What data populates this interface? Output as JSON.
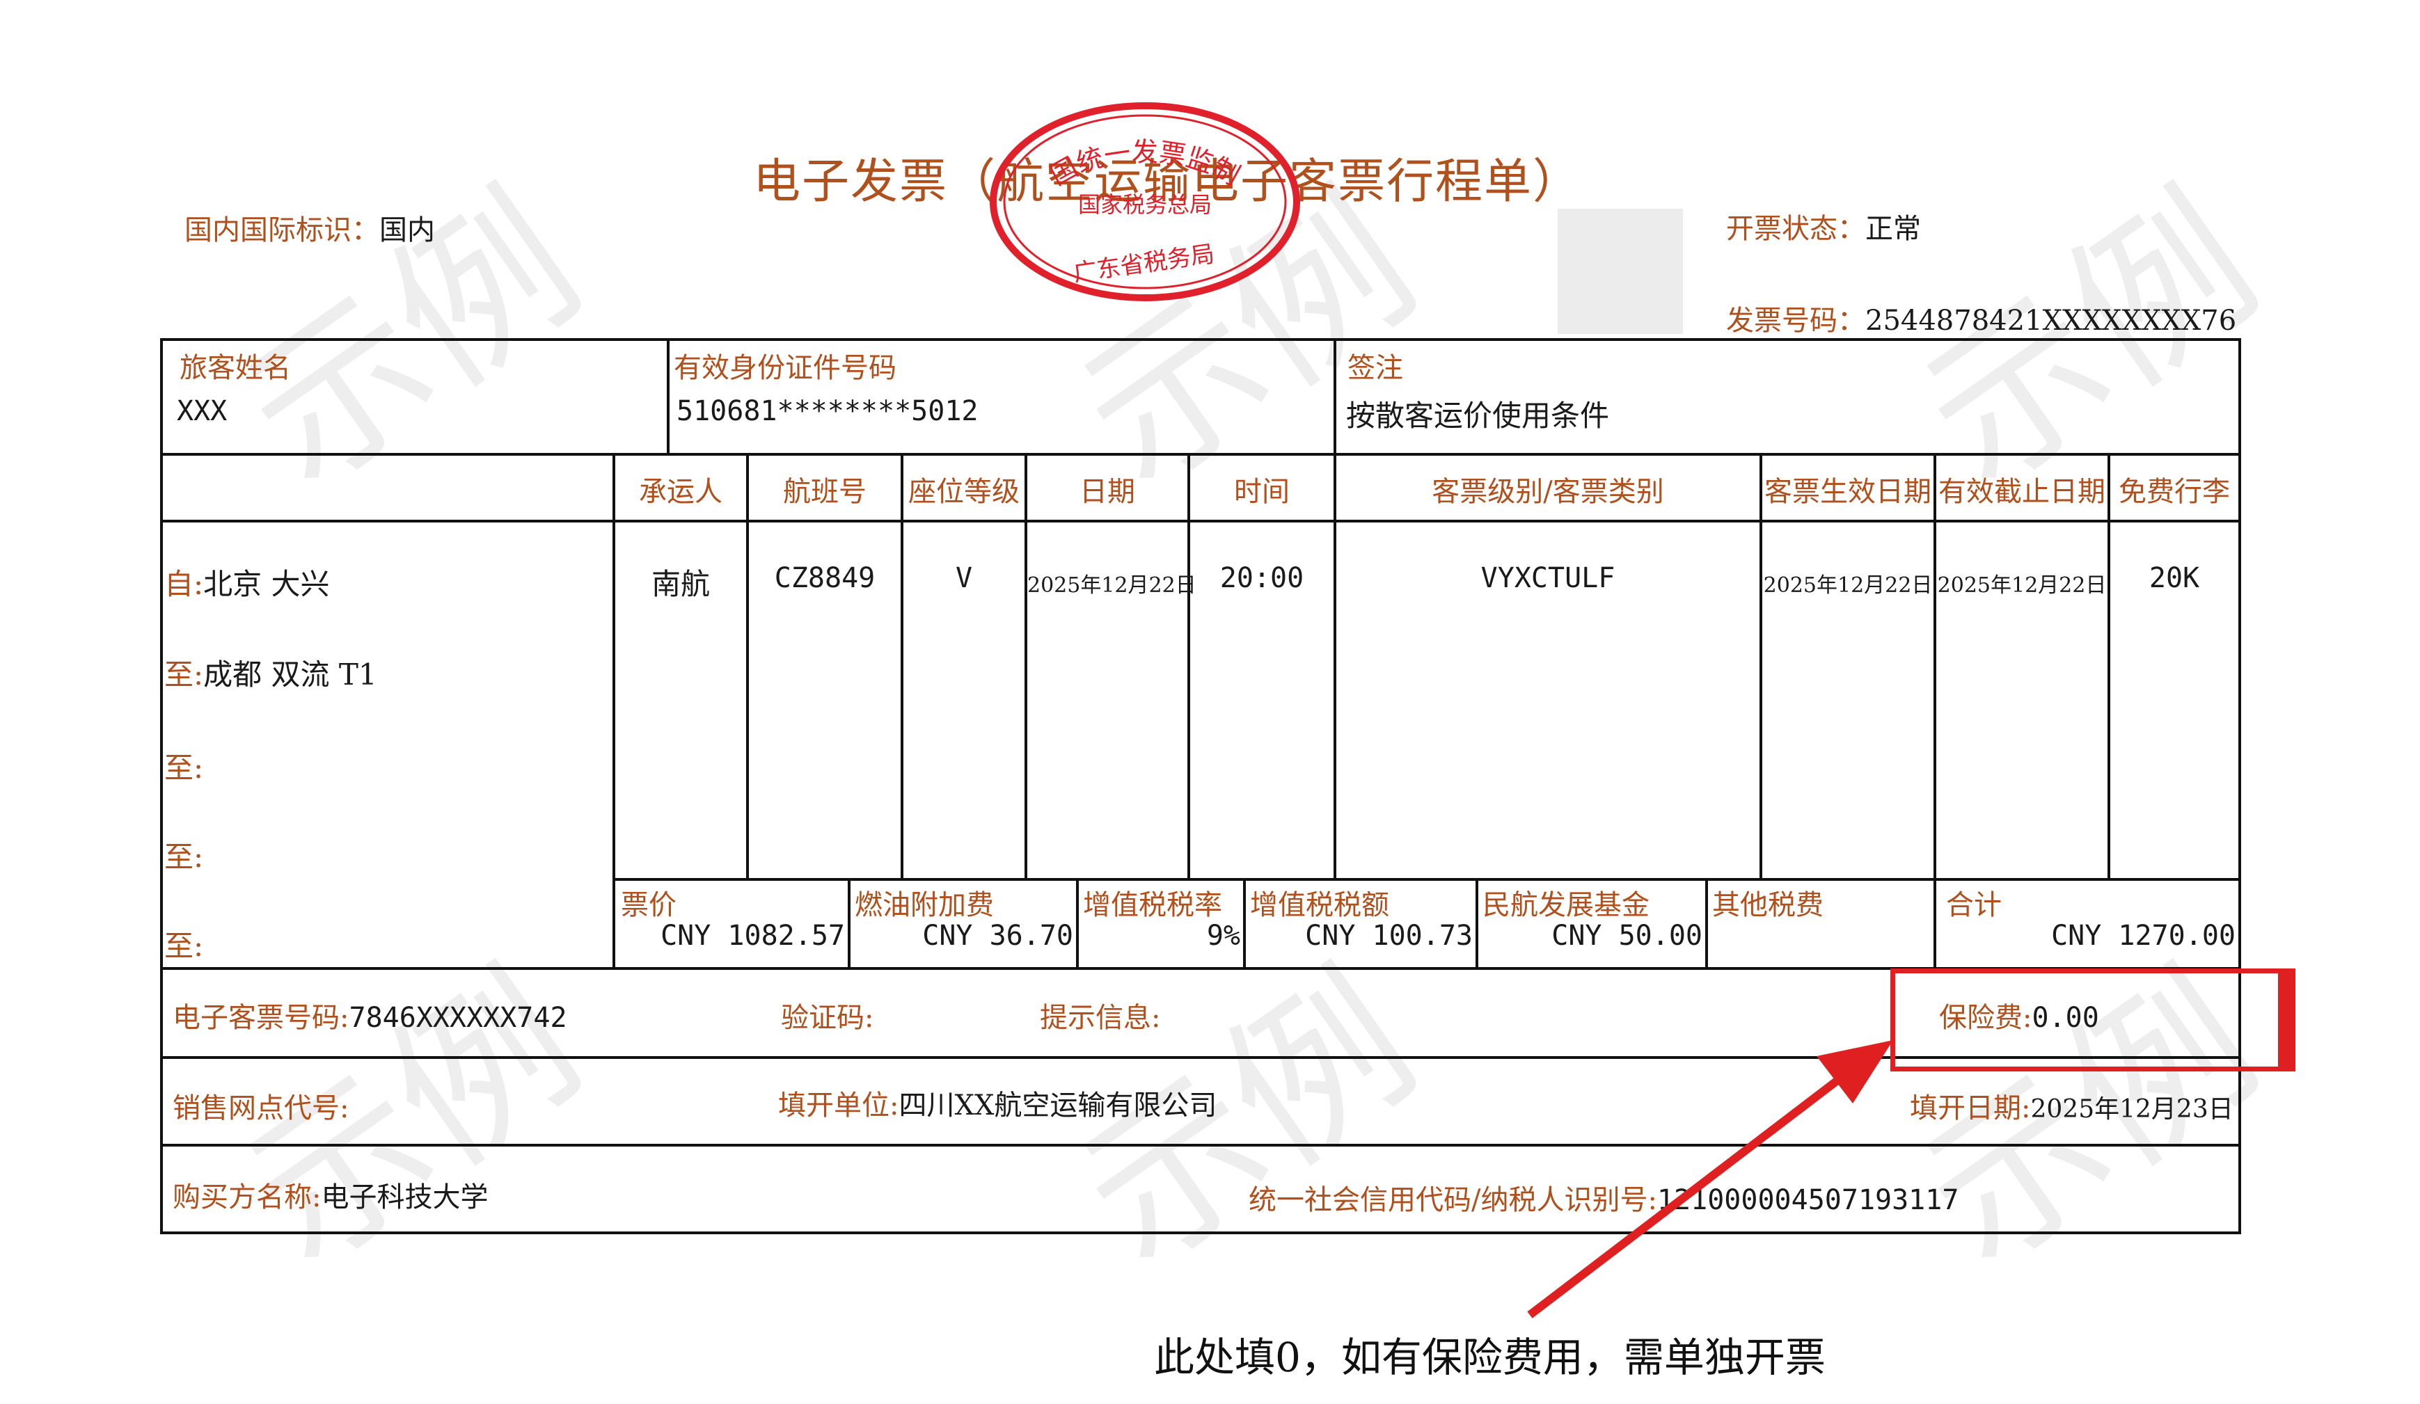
{
  "header": {
    "title": "电子发票（航空运输电子客票行程单）",
    "domestic_label": "国内国际标识：",
    "domestic_value": "国内",
    "status_label": "开票状态：",
    "status_value": "正常",
    "invoice_no_label": "发票号码：",
    "invoice_no_value": "2544878421XXXXXXXX76"
  },
  "seal": {
    "top_text": "国统一发票监制",
    "middle_text": "国家税务总局",
    "bottom_text": "广东省税务局",
    "color": "#e0202a"
  },
  "watermark": {
    "text": "示例"
  },
  "passenger": {
    "name_label": "旅客姓名",
    "name_value": "XXX",
    "id_label": "有效身份证件号码",
    "id_value": "510681********5012",
    "endorse_label": "签注",
    "endorse_value": "按散客运价使用条件"
  },
  "flight_headers": {
    "carrier": "承运人",
    "flight_no": "航班号",
    "seat_class": "座位等级",
    "date": "日期",
    "time": "时间",
    "fare_basis": "客票级别/客票类别",
    "valid_from": "客票生效日期",
    "valid_to": "有效截止日期",
    "baggage": "免费行李"
  },
  "route": {
    "from_label": "自:",
    "from_value": "北京 大兴",
    "to1_label": "至:",
    "to1_value": "成都 双流 T1",
    "to2_label": "至:",
    "to3_label": "至:",
    "to4_label": "至:"
  },
  "flight": {
    "carrier": "南航",
    "flight_no": "CZ8849",
    "seat_class": "V",
    "date": "2025年12月22日",
    "time": "20:00",
    "fare_basis": "VYXCTULF",
    "valid_from": "2025年12月22日",
    "valid_to": "2025年12月22日",
    "baggage": "20K"
  },
  "fees": {
    "fare_label": "票价",
    "fare_value": "CNY 1082.57",
    "fuel_label": "燃油附加费",
    "fuel_value": "CNY 36.70",
    "vat_rate_label": "增值税税率",
    "vat_rate_value": "9%",
    "vat_amount_label": "增值税税额",
    "vat_amount_value": "CNY 100.73",
    "caac_label": "民航发展基金",
    "caac_value": "CNY 50.00",
    "other_label": "其他税费",
    "total_label": "合计",
    "total_value": "CNY 1270.00"
  },
  "ticket": {
    "eticket_label": "电子客票号码:",
    "eticket_value": "7846XXXXXX742",
    "verify_label": "验证码:",
    "notice_label": "提示信息:",
    "insurance_label": "保险费:",
    "insurance_value": "0.00"
  },
  "issuer": {
    "agent_label": "销售网点代号:",
    "unit_label": "填开单位:",
    "unit_value": "四川XX航空运输有限公司",
    "date_label": "填开日期:",
    "date_value": "2025年12月23日"
  },
  "buyer": {
    "name_label": "购买方名称:",
    "name_value": "电子科技大学",
    "taxid_label": "统一社会信用代码/纳税人识别号:",
    "taxid_value": "121000004507193117"
  },
  "annotation": {
    "text": "此处填0，如有保险费用，需单独开票",
    "color": "#e02020"
  }
}
